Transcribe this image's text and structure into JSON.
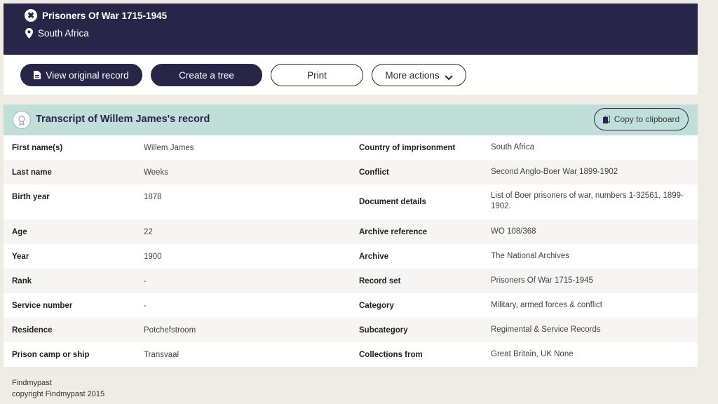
{
  "header": {
    "collection_title": "Prisoners Of War 1715-1945",
    "location": "South Africa"
  },
  "actions": {
    "view_original": "View original record",
    "create_tree": "Create a tree",
    "print": "Print",
    "more_actions": "More actions"
  },
  "transcript": {
    "title": "Transcript of Willem James's record",
    "copy_label": "Copy to clipboard"
  },
  "rows": [
    {
      "l1": "First name(s)",
      "v1": "Willem James",
      "l2": "Country of imprisonment",
      "v2": "South Africa"
    },
    {
      "l1": "Last name",
      "v1": "Weeks",
      "l2": "Conflict",
      "v2": "Second Anglo-Boer War 1899-1902"
    },
    {
      "l1": "Birth year",
      "v1": "1878",
      "l2": "Document details",
      "v2": "List of Boer prisoners of war, numbers 1-32561, 1899-1902."
    },
    {
      "l1": "Age",
      "v1": "22",
      "l2": "Archive reference",
      "v2": "WO 108/368"
    },
    {
      "l1": "Year",
      "v1": "1900",
      "l2": "Archive",
      "v2": "The National Archives"
    },
    {
      "l1": "Rank",
      "v1": "-",
      "l2": "Record set",
      "v2": "Prisoners Of War 1715-1945"
    },
    {
      "l1": "Service number",
      "v1": "-",
      "l2": "Category",
      "v2": "Military, armed forces & conflict"
    },
    {
      "l1": "Residence",
      "v1": "Potchefstroom",
      "l2": "Subcategory",
      "v2": "Regimental & Service Records"
    },
    {
      "l1": "Prison camp or ship",
      "v1": "Transvaal",
      "l2": "Collections from",
      "v2": "Great Britain, UK None"
    }
  ],
  "footer": {
    "brand": "Findmypast",
    "copyright": "copyright Findmypast 2015"
  }
}
